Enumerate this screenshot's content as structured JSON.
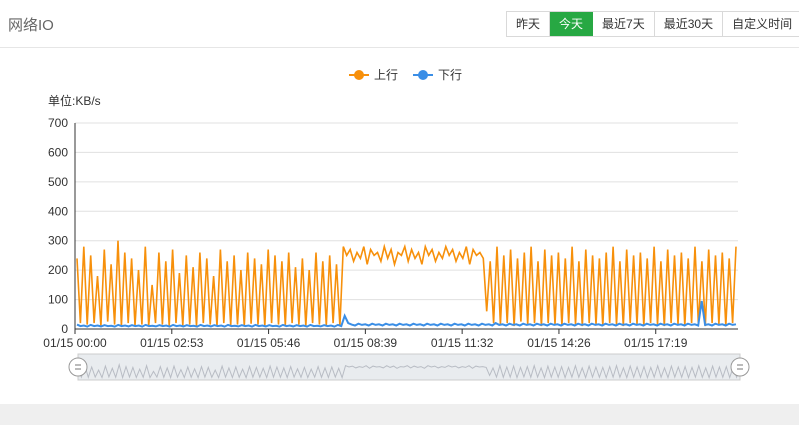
{
  "header": {
    "title": "网络IO",
    "range_buttons": [
      {
        "label": "昨天",
        "active": false
      },
      {
        "label": "今天",
        "active": true
      },
      {
        "label": "最近7天",
        "active": false
      },
      {
        "label": "最近30天",
        "active": false
      },
      {
        "label": "自定义时间",
        "active": false
      }
    ]
  },
  "colors": {
    "upload": "#f7900b",
    "download": "#3a8ee6",
    "active_button": "#27a843"
  },
  "chart_data": {
    "type": "line",
    "unit_label": "单位:KB/s",
    "ylim": [
      0,
      700
    ],
    "yticks": [
      0,
      100,
      200,
      300,
      400,
      500,
      600,
      700
    ],
    "xticks": [
      "01/15 00:00",
      "01/15 02:53",
      "01/15 05:46",
      "01/15 08:39",
      "01/15 11:32",
      "01/15 14:26",
      "01/15 17:19"
    ],
    "legend_position": "top-center",
    "grid": true,
    "series": [
      {
        "name": "上行",
        "values": [
          240,
          20,
          280,
          15,
          250,
          20,
          180,
          10,
          270,
          25,
          220,
          15,
          300,
          10,
          260,
          20,
          240,
          12,
          200,
          15,
          280,
          10,
          150,
          20,
          260,
          15,
          230,
          10,
          270,
          20,
          190,
          12,
          250,
          15,
          210,
          10,
          260,
          20,
          240,
          15,
          180,
          10,
          270,
          20,
          230,
          12,
          250,
          15,
          200,
          10,
          260,
          18,
          240,
          15,
          220,
          10,
          270,
          20,
          250,
          15,
          230,
          12,
          260,
          20,
          210,
          15,
          240,
          10,
          200,
          20,
          260,
          15,
          230,
          12,
          250,
          20,
          220,
          10,
          280,
          250,
          270,
          230,
          260,
          240,
          280,
          220,
          270,
          250,
          260,
          230,
          280,
          240,
          270,
          220,
          260,
          250,
          280,
          230,
          270,
          240,
          260,
          220,
          280,
          250,
          270,
          230,
          260,
          240,
          280,
          250,
          270,
          230,
          260,
          240,
          280,
          220,
          270,
          250,
          260,
          240,
          60,
          230,
          20,
          280,
          15,
          250,
          20,
          270,
          10,
          240,
          25,
          260,
          15,
          280,
          20,
          230,
          10,
          270,
          20,
          250,
          15,
          260,
          10,
          240,
          20,
          280,
          15,
          230,
          10,
          270,
          20,
          250,
          15,
          240,
          10,
          260,
          20,
          280,
          15,
          230,
          10,
          270,
          20,
          250,
          15,
          260,
          10,
          240,
          20,
          280,
          15,
          230,
          10,
          270,
          20,
          250,
          15,
          260,
          10,
          240,
          20,
          280,
          15,
          230,
          10,
          270,
          20,
          250,
          15,
          260,
          10,
          240,
          20,
          280
        ],
        "approximate": true
      },
      {
        "name": "下行",
        "values": [
          15,
          10,
          12,
          8,
          14,
          10,
          12,
          9,
          13,
          10,
          11,
          8,
          14,
          10,
          12,
          9,
          13,
          10,
          12,
          8,
          14,
          10,
          11,
          9,
          13,
          10,
          12,
          8,
          14,
          10,
          12,
          9,
          13,
          10,
          11,
          8,
          14,
          10,
          12,
          9,
          13,
          10,
          12,
          8,
          14,
          10,
          11,
          9,
          13,
          10,
          12,
          8,
          14,
          10,
          12,
          9,
          13,
          10,
          11,
          8,
          14,
          10,
          12,
          9,
          13,
          10,
          12,
          8,
          14,
          10,
          11,
          9,
          13,
          10,
          12,
          8,
          14,
          10,
          45,
          20,
          15,
          12,
          18,
          14,
          16,
          12,
          18,
          14,
          16,
          12,
          18,
          14,
          16,
          12,
          18,
          14,
          16,
          12,
          18,
          14,
          16,
          12,
          18,
          14,
          16,
          12,
          18,
          14,
          16,
          12,
          18,
          14,
          16,
          12,
          18,
          14,
          16,
          12,
          18,
          14,
          16,
          12,
          20,
          14,
          16,
          12,
          18,
          14,
          16,
          12,
          18,
          14,
          16,
          12,
          18,
          14,
          16,
          12,
          18,
          14,
          16,
          12,
          18,
          14,
          16,
          12,
          18,
          14,
          16,
          12,
          18,
          14,
          16,
          12,
          18,
          14,
          16,
          12,
          18,
          14,
          16,
          12,
          18,
          14,
          16,
          12,
          18,
          14,
          16,
          12,
          18,
          14,
          16,
          12,
          18,
          14,
          16,
          12,
          18,
          14,
          16,
          12,
          95,
          14,
          16,
          12,
          18,
          14,
          16,
          12,
          18,
          14,
          16
        ],
        "approximate": true
      }
    ]
  },
  "slider": {
    "start_fraction": 0,
    "end_fraction": 1
  }
}
